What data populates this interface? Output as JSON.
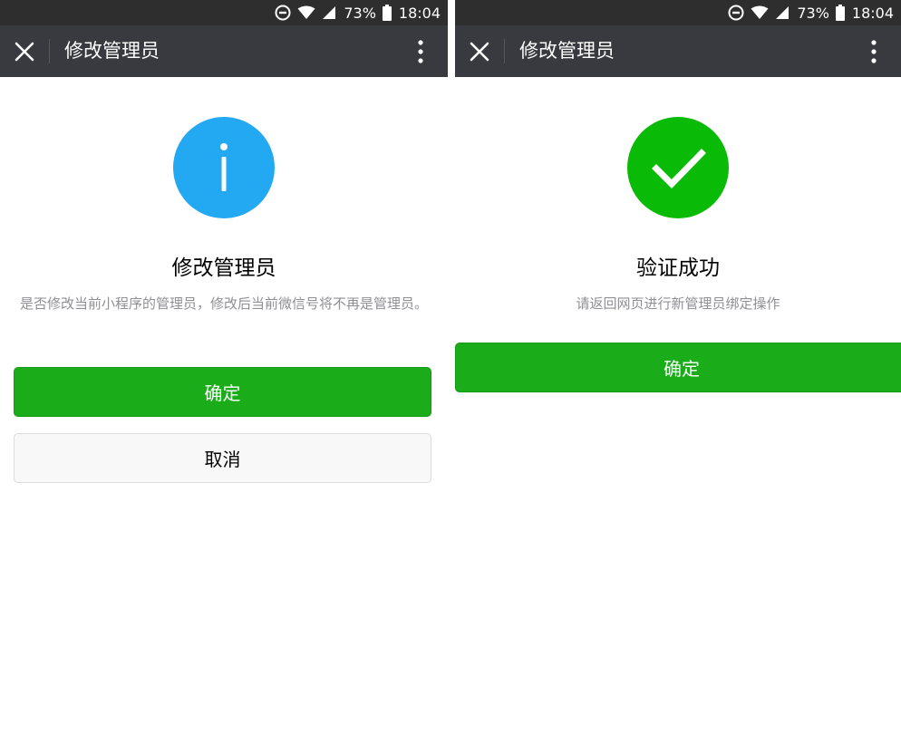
{
  "status_bar": {
    "battery_percent": "73%",
    "time": "18:04",
    "icons": [
      "do-not-disturb-icon",
      "wifi-icon",
      "signal-icon",
      "battery-icon"
    ]
  },
  "screens": [
    {
      "nav_title": "修改管理员",
      "icon": "info-icon",
      "icon_color": "#23a8f2",
      "title": "修改管理员",
      "description": "是否修改当前小程序的管理员，修改后当前微信号将不再是管理员。",
      "buttons": {
        "confirm": "确定",
        "cancel": "取消"
      }
    },
    {
      "nav_title": "修改管理员",
      "icon": "success-check-icon",
      "icon_color": "#09bb07",
      "title": "验证成功",
      "description": "请返回网页进行新管理员绑定操作",
      "buttons": {
        "confirm": "确定"
      }
    }
  ],
  "colors": {
    "nav_bg": "#393a3f",
    "status_bg": "#2e2e2e",
    "primary_button": "#1aad19",
    "description_text": "#8f8f94"
  }
}
